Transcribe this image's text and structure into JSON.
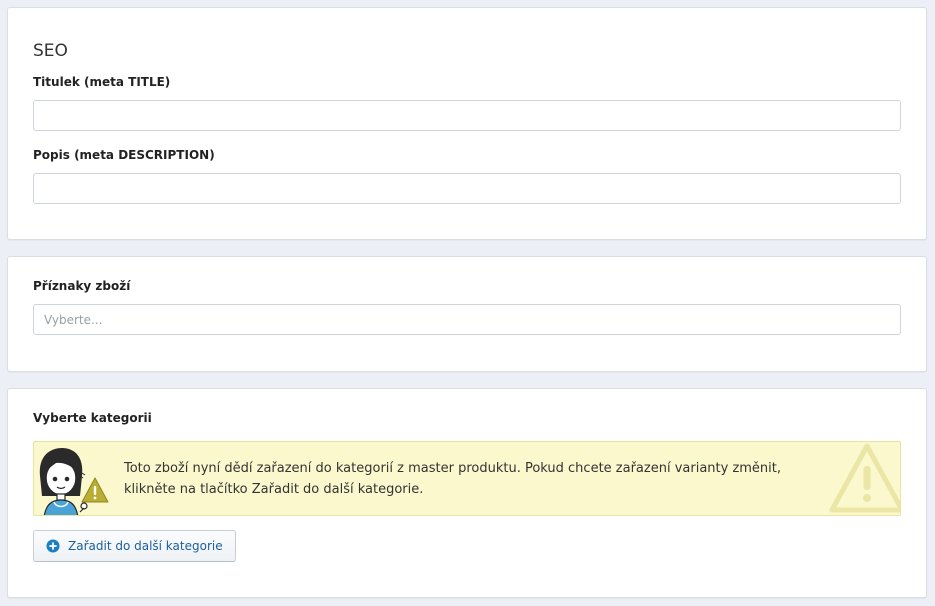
{
  "seo": {
    "title": "SEO",
    "meta_title_label": "Titulek (meta TITLE)",
    "meta_title_value": "",
    "meta_description_label": "Popis (meta DESCRIPTION)",
    "meta_description_value": ""
  },
  "flags": {
    "label": "Příznaky zboží",
    "placeholder": "Vyberte..."
  },
  "categories": {
    "label": "Vyberte kategorii",
    "notice_text": "Toto zboží nyní dědí zařazení do kategorií z master produktu. Pokud chcete zařazení varianty změnit, klikněte na tlačítko Zařadit do další kategorie.",
    "add_button_label": "Zařadit do další kategorie",
    "add_icon": "plus-circle-icon",
    "notice_icon": "warning-icon"
  },
  "colors": {
    "page_bg": "#eceff5",
    "notice_bg": "#fbf8cd",
    "button_text": "#1a5f9e",
    "warning": "#c3b63a"
  }
}
